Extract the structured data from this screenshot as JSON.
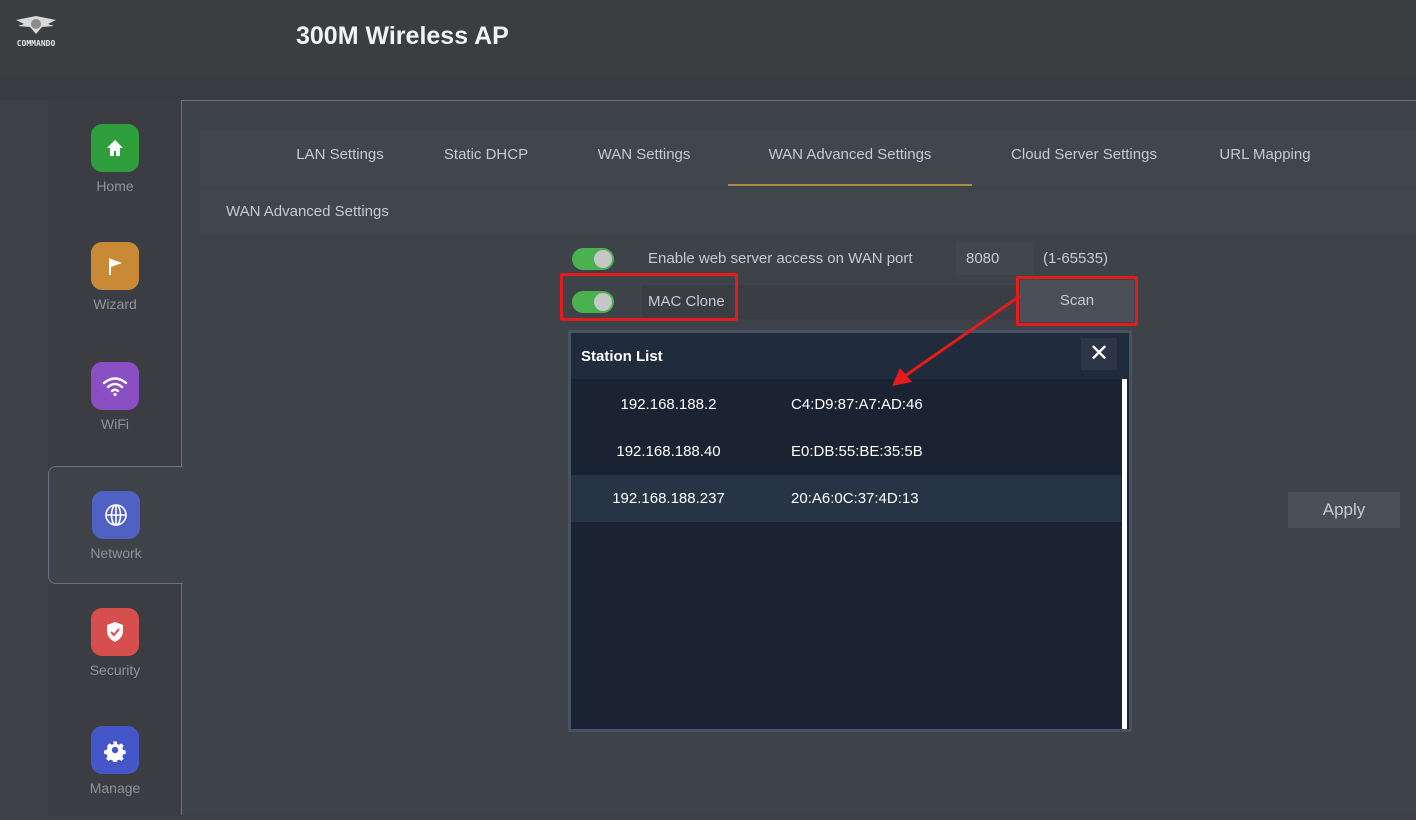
{
  "header": {
    "logo_text": "COMMANDO",
    "title": "300M Wireless AP"
  },
  "sidebar": {
    "items": [
      {
        "label": "Home",
        "icon": "home-icon",
        "color": "#2f9e3c"
      },
      {
        "label": "Wizard",
        "icon": "flag-icon",
        "color": "#c98a37"
      },
      {
        "label": "WiFi",
        "icon": "wifi-icon",
        "color": "#8a4fc2"
      },
      {
        "label": "Network",
        "icon": "globe-icon",
        "color": "#4f62c4",
        "active": true
      },
      {
        "label": "Security",
        "icon": "shield-icon",
        "color": "#d74e4e"
      },
      {
        "label": "Manage",
        "icon": "gear-icon",
        "color": "#4556c8"
      }
    ]
  },
  "tabs": [
    {
      "label": "LAN Settings"
    },
    {
      "label": "Static DHCP"
    },
    {
      "label": "WAN Settings"
    },
    {
      "label": "WAN Advanced Settings",
      "active": true
    },
    {
      "label": "Cloud Server Settings"
    },
    {
      "label": "URL Mapping"
    }
  ],
  "section_title": "WAN Advanced Settings",
  "form": {
    "web_access_label": "Enable web server access on WAN port",
    "port_value": "8080",
    "port_range": "(1-65535)",
    "mac_clone_label": "MAC Clone",
    "mac_value": "",
    "scan_label": "Scan",
    "apply_label": "Apply"
  },
  "modal": {
    "title": "Station List",
    "close_symbol": "✕",
    "stations": [
      {
        "ip": "192.168.188.2",
        "mac": "C4:D9:87:A7:AD:46"
      },
      {
        "ip": "192.168.188.40",
        "mac": "E0:DB:55:BE:35:5B"
      },
      {
        "ip": "192.168.188.237",
        "mac": "20:A6:0C:37:4D:13"
      }
    ]
  },
  "colors": {
    "toggle_on": "#49b24f",
    "annotation": "#e31b1b",
    "active_tab_underline": "#b08a4c"
  }
}
